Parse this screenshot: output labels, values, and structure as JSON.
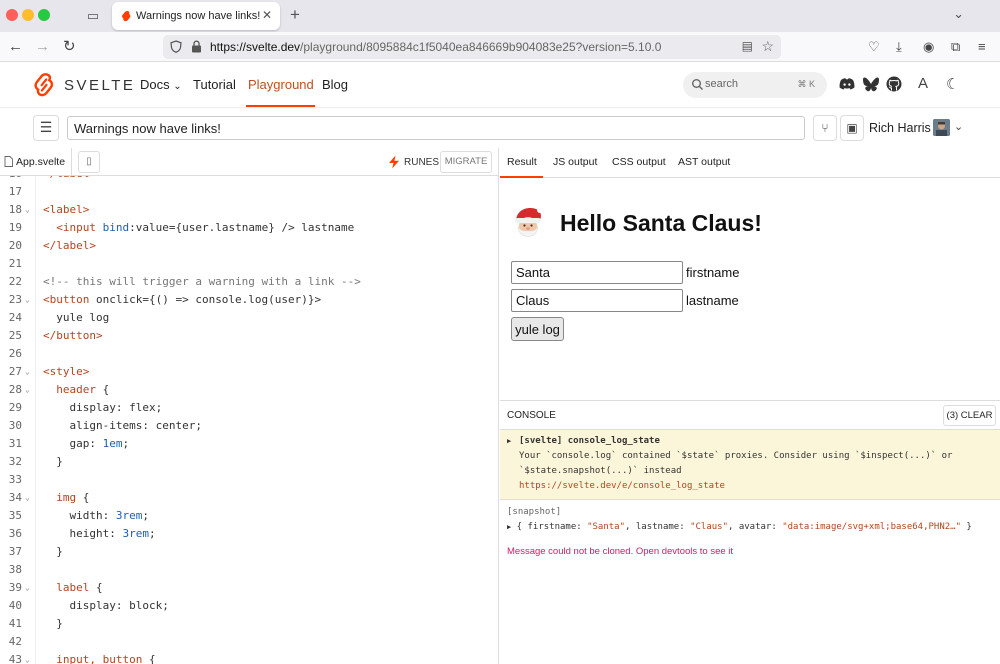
{
  "browser": {
    "tab_title": "Warnings now have links! · Playground",
    "url_host": "https://svelte.dev",
    "url_rest": "/playground/8095884c1f5040ea846669b904083e25?version=5.10.0"
  },
  "site": {
    "brand": "SVELTE",
    "nav": [
      "Docs",
      "Tutorial",
      "Playground",
      "Blog"
    ],
    "search_label": "search",
    "search_shortcut": "⌘ K",
    "accent": "#ff3e00"
  },
  "playground": {
    "title": "Warnings now have links!",
    "user_name": "Rich Harris"
  },
  "editor": {
    "file_tab": "App.svelte",
    "runes_label": "RUNES",
    "migrate_label": "MIGRATE",
    "lines": [
      {
        "n": "16",
        "fold": false,
        "html": "<span class=\"t-tag\">&lt;/label&gt;</span>"
      },
      {
        "n": "17",
        "fold": false,
        "html": ""
      },
      {
        "n": "18",
        "fold": true,
        "html": "<span class=\"t-tag\">&lt;label&gt;</span>"
      },
      {
        "n": "19",
        "fold": false,
        "html": "  <span class=\"t-tag\">&lt;input</span> <span class=\"t-attr\">bind</span>:value={user.lastname} /&gt; lastname"
      },
      {
        "n": "20",
        "fold": false,
        "html": "<span class=\"t-tag\">&lt;/label&gt;</span>"
      },
      {
        "n": "21",
        "fold": false,
        "html": ""
      },
      {
        "n": "22",
        "fold": false,
        "html": "<span class=\"t-cmt\">&lt;!-- this will trigger a warning with a link --&gt;</span>"
      },
      {
        "n": "23",
        "fold": true,
        "html": "<span class=\"t-tag\">&lt;button</span> onclick={() =&gt; console.log(user)}&gt;"
      },
      {
        "n": "24",
        "fold": false,
        "html": "  yule log"
      },
      {
        "n": "25",
        "fold": false,
        "html": "<span class=\"t-tag\">&lt;/button&gt;</span>"
      },
      {
        "n": "26",
        "fold": false,
        "html": ""
      },
      {
        "n": "27",
        "fold": true,
        "html": "<span class=\"t-tag\">&lt;style&gt;</span>"
      },
      {
        "n": "28",
        "fold": true,
        "html": "  <span class=\"t-prop\">header</span> {"
      },
      {
        "n": "29",
        "fold": false,
        "html": "    display: flex;"
      },
      {
        "n": "30",
        "fold": false,
        "html": "    align-items: center;"
      },
      {
        "n": "31",
        "fold": false,
        "html": "    gap: <span class=\"t-num\">1em</span>;"
      },
      {
        "n": "32",
        "fold": false,
        "html": "  }"
      },
      {
        "n": "33",
        "fold": false,
        "html": ""
      },
      {
        "n": "34",
        "fold": true,
        "html": "  <span class=\"t-prop\">img</span> {"
      },
      {
        "n": "35",
        "fold": false,
        "html": "    width: <span class=\"t-num\">3rem</span>;"
      },
      {
        "n": "36",
        "fold": false,
        "html": "    height: <span class=\"t-num\">3rem</span>;"
      },
      {
        "n": "37",
        "fold": false,
        "html": "  }"
      },
      {
        "n": "38",
        "fold": false,
        "html": ""
      },
      {
        "n": "39",
        "fold": true,
        "html": "  <span class=\"t-prop\">label</span> {"
      },
      {
        "n": "40",
        "fold": false,
        "html": "    display: block;"
      },
      {
        "n": "41",
        "fold": false,
        "html": "  }"
      },
      {
        "n": "42",
        "fold": false,
        "html": ""
      },
      {
        "n": "43",
        "fold": true,
        "html": "  <span class=\"t-prop\">input, button</span> {"
      }
    ]
  },
  "output": {
    "tabs": [
      "Result",
      "JS output",
      "CSS output",
      "AST output"
    ],
    "heading": "Hello Santa Claus!",
    "firstname_value": "Santa",
    "firstname_label": "firstname",
    "lastname_value": "Claus",
    "lastname_label": "lastname",
    "button_label": "yule log"
  },
  "console": {
    "title": "CONSOLE",
    "clear_label": "(3) CLEAR",
    "warning_title": "[svelte] console_log_state",
    "warning_line1": "Your `console.log` contained `$state` proxies. Consider using `$inspect(...)` or",
    "warning_line2": "`$state.snapshot(...)` instead",
    "warning_link": "https://svelte.dev/e/console_log_state",
    "snapshot_label": "[snapshot]",
    "snapshot_firstname": "\"Santa\"",
    "snapshot_lastname": "\"Claus\"",
    "snapshot_avatar": "\"data:image/svg+xml;base64,PHN2…\"",
    "error_message": "Message could not be cloned. Open devtools to see it"
  }
}
